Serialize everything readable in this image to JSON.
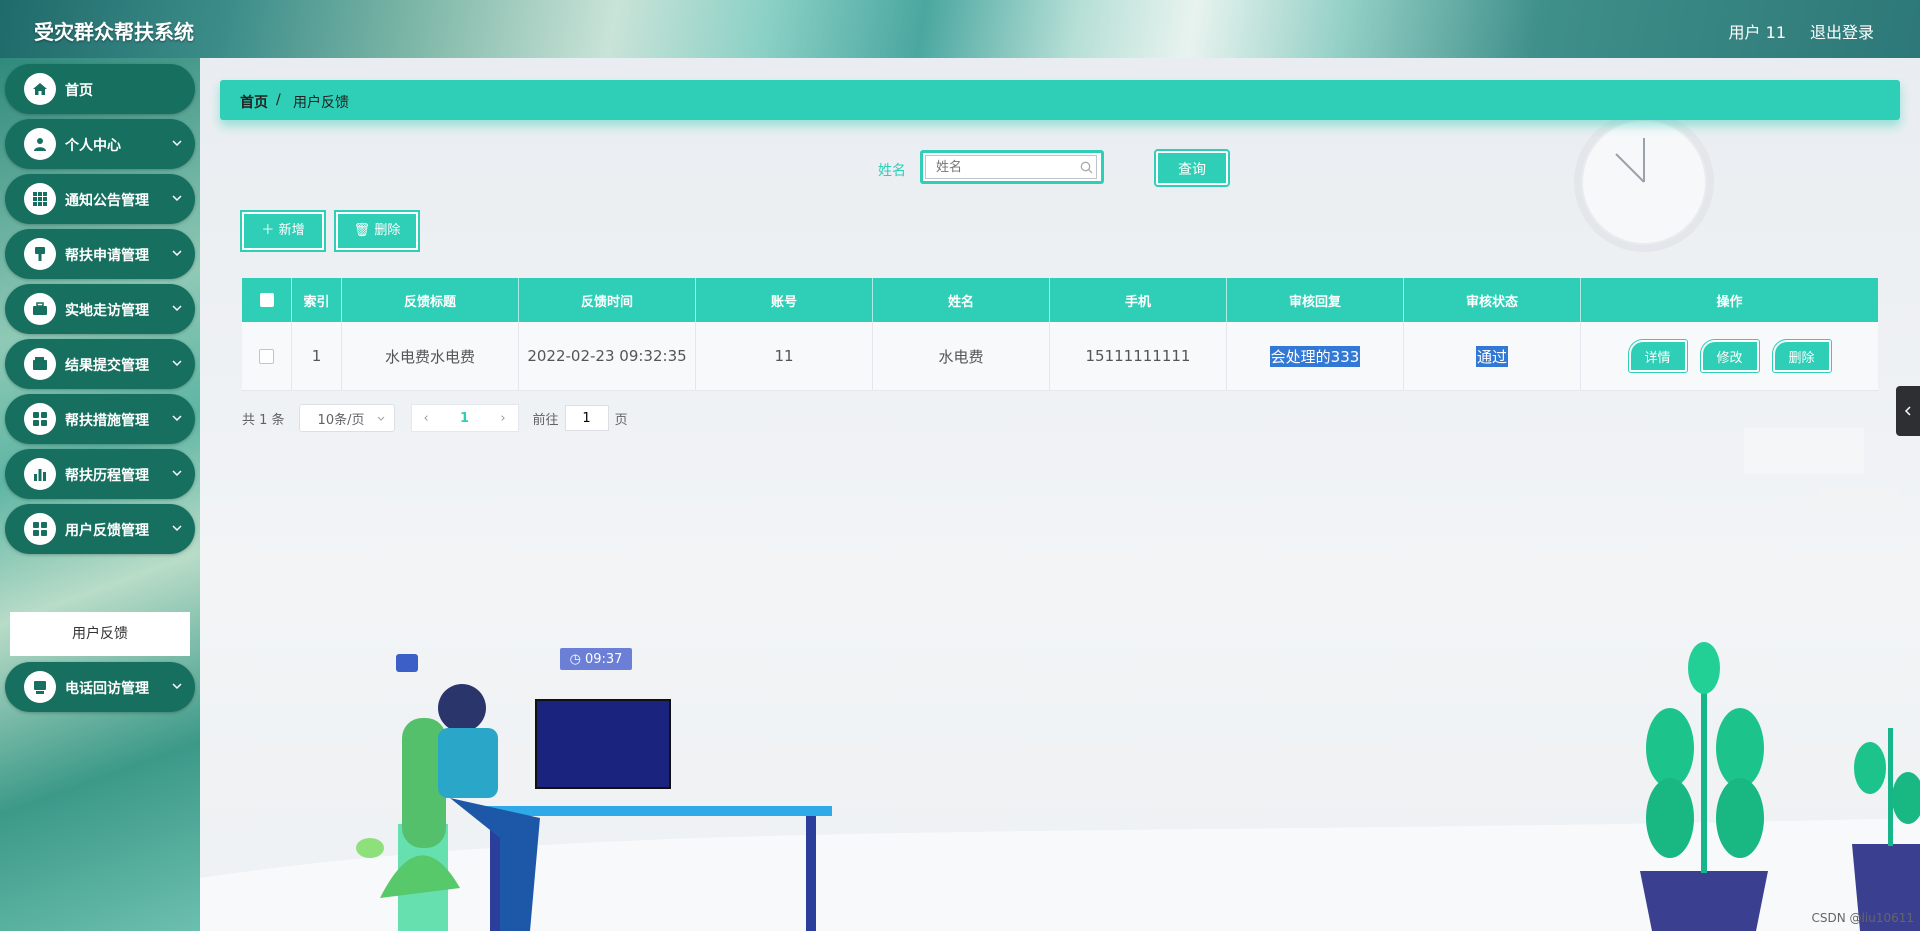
{
  "header": {
    "title": "受灾群众帮扶系统",
    "user": "用户 11",
    "logout": "退出登录"
  },
  "sidebar": {
    "items": [
      {
        "label": "首页",
        "icon": "home-icon"
      },
      {
        "label": "个人中心",
        "icon": "user-icon"
      },
      {
        "label": "通知公告管理",
        "icon": "grid-icon"
      },
      {
        "label": "帮扶申请管理",
        "icon": "brush-icon"
      },
      {
        "label": "实地走访管理",
        "icon": "briefcase-icon"
      },
      {
        "label": "结果提交管理",
        "icon": "wallet-icon"
      },
      {
        "label": "帮扶措施管理",
        "icon": "apps-icon"
      },
      {
        "label": "帮扶历程管理",
        "icon": "chart-icon"
      },
      {
        "label": "用户反馈管理",
        "icon": "apps-icon"
      },
      {
        "label": "电话回访管理",
        "icon": "monitor-icon"
      }
    ],
    "submenu_active": "用户反馈"
  },
  "breadcrumb": {
    "home": "首页",
    "sep": "/",
    "current": "用户反馈"
  },
  "search": {
    "label": "姓名",
    "placeholder": "姓名",
    "button": "查询"
  },
  "toolbar": {
    "add": "新增",
    "delete": "删除"
  },
  "table": {
    "headers": [
      "索引",
      "反馈标题",
      "反馈时间",
      "账号",
      "姓名",
      "手机",
      "审核回复",
      "审核状态",
      "操作"
    ],
    "rows": [
      {
        "index": "1",
        "title": "水电费水电费",
        "time": "2022-02-23 09:32:35",
        "account": "11",
        "name": "水电费",
        "phone": "15111111111",
        "reply": "会处理的333",
        "status": "通过"
      }
    ],
    "actions": {
      "detail": "详情",
      "edit": "修改",
      "delete": "删除"
    }
  },
  "pagination": {
    "total": "共 1 条",
    "page_size": "10条/页",
    "current_page": "1",
    "goto_label": "前往",
    "goto_value": "1",
    "page_unit": "页"
  },
  "illustration": {
    "clock_time": "09:37"
  },
  "watermark": "CSDN @liu10611",
  "colors": {
    "accent": "#2ecfb6",
    "sidebar_item": "#17705f",
    "selection": "#3478d6"
  }
}
